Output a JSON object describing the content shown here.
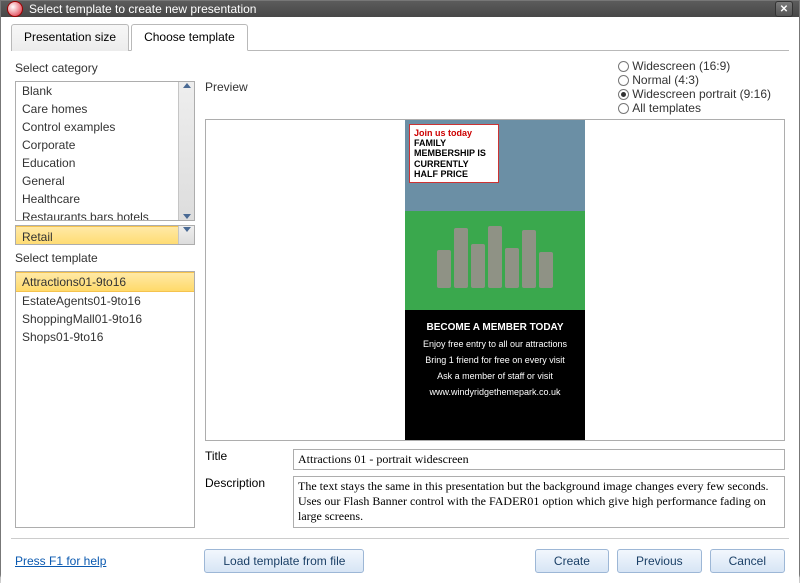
{
  "title": "Select template to create new presentation",
  "tabs": [
    "Presentation size",
    "Choose template"
  ],
  "active_tab": 1,
  "category": {
    "label": "Select category",
    "items": [
      "Blank",
      "Care homes",
      "Control examples",
      "Corporate",
      "Education",
      "General",
      "Healthcare",
      "Restaurants bars hotels"
    ],
    "selected": "Retail"
  },
  "template_list": {
    "label": "Select template",
    "items": [
      "Attractions01-9to16",
      "EstateAgents01-9to16",
      "ShoppingMall01-9to16",
      "Shops01-9to16"
    ],
    "selected_index": 0
  },
  "preview": {
    "label": "Preview",
    "radio_options": [
      "Widescreen (16:9)",
      "Normal (4:3)",
      "Widescreen portrait (9:16)",
      "All templates"
    ],
    "radio_selected_index": 2,
    "poster": {
      "callout_red": "Join us today",
      "callout_bold": "FAMILY MEMBERSHIP IS CURRENTLY HALF PRICE",
      "headline": "BECOME A MEMBER TODAY",
      "lines": [
        "Enjoy free entry to all our attractions",
        "Bring 1 friend for free on every visit",
        "Ask a member of staff or visit",
        "www.windyridgethemepark.co.uk"
      ]
    }
  },
  "meta": {
    "title_label": "Title",
    "title_value": "Attractions 01 - portrait widescreen",
    "desc_label": "Description",
    "desc_value": "The text stays the same in this presentation but the background image changes every few seconds. Uses our Flash Banner control with the FADER01 option which give high performance fading on large screens."
  },
  "footer": {
    "help": "Press F1 for help",
    "load": "Load template from file",
    "create": "Create",
    "previous": "Previous",
    "cancel": "Cancel"
  }
}
